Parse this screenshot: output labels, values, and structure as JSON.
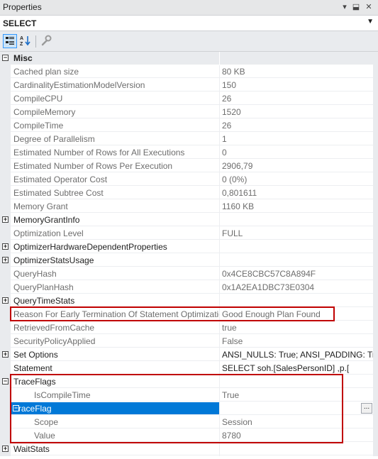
{
  "window": {
    "title": "Properties",
    "dropdown_icon": "▾",
    "pin_icon": "⬓",
    "close_icon": "✕"
  },
  "object_selector": {
    "value": "SELECT"
  },
  "toolbar": {
    "categorized": "categorized-icon",
    "alphabetical": "alphabetical-icon",
    "pages": "wrench-icon"
  },
  "category": {
    "name": "Misc"
  },
  "rows": [
    {
      "name": "Cached plan size",
      "value": "80 KB"
    },
    {
      "name": "CardinalityEstimationModelVersion",
      "value": "150"
    },
    {
      "name": "CompileCPU",
      "value": "26"
    },
    {
      "name": "CompileMemory",
      "value": "1520"
    },
    {
      "name": "CompileTime",
      "value": "26"
    },
    {
      "name": "Degree of Parallelism",
      "value": "1"
    },
    {
      "name": "Estimated Number of Rows for All Executions",
      "value": "0"
    },
    {
      "name": "Estimated Number of Rows Per Execution",
      "value": "2906,79"
    },
    {
      "name": "Estimated Operator Cost",
      "value": "0 (0%)"
    },
    {
      "name": "Estimated Subtree Cost",
      "value": "0,801611"
    },
    {
      "name": "Memory Grant",
      "value": "1160 KB"
    },
    {
      "name": "MemoryGrantInfo",
      "value": ""
    },
    {
      "name": "Optimization Level",
      "value": "FULL"
    },
    {
      "name": "OptimizerHardwareDependentProperties",
      "value": ""
    },
    {
      "name": "OptimizerStatsUsage",
      "value": ""
    },
    {
      "name": "QueryHash",
      "value": "0x4CE8CBC57C8A894F"
    },
    {
      "name": "QueryPlanHash",
      "value": "0x1A2EA1DBC73E0304"
    },
    {
      "name": "QueryTimeStats",
      "value": ""
    },
    {
      "name": "Reason For Early Termination Of Statement Optimization",
      "value": "Good Enough Plan Found"
    },
    {
      "name": "RetrievedFromCache",
      "value": "true"
    },
    {
      "name": "SecurityPolicyApplied",
      "value": "False"
    },
    {
      "name": "Set Options",
      "value": "ANSI_NULLS: True; ANSI_PADDING: True; ANSI_WARNINGS: True"
    },
    {
      "name": "Statement",
      "value": "SELECT        soh.[SalesPersonID]        ,p.["
    },
    {
      "name": "TraceFlags",
      "value": ""
    },
    {
      "name": "IsCompileTime",
      "value": "True"
    },
    {
      "name": "TraceFlag",
      "value": ""
    },
    {
      "name": "Scope",
      "value": "Session"
    },
    {
      "name": "Value",
      "value": "8780"
    },
    {
      "name": "WaitStats",
      "value": ""
    }
  ],
  "expander_collapsed": "+",
  "expander_expanded": "−",
  "ellipsis_label": "..."
}
